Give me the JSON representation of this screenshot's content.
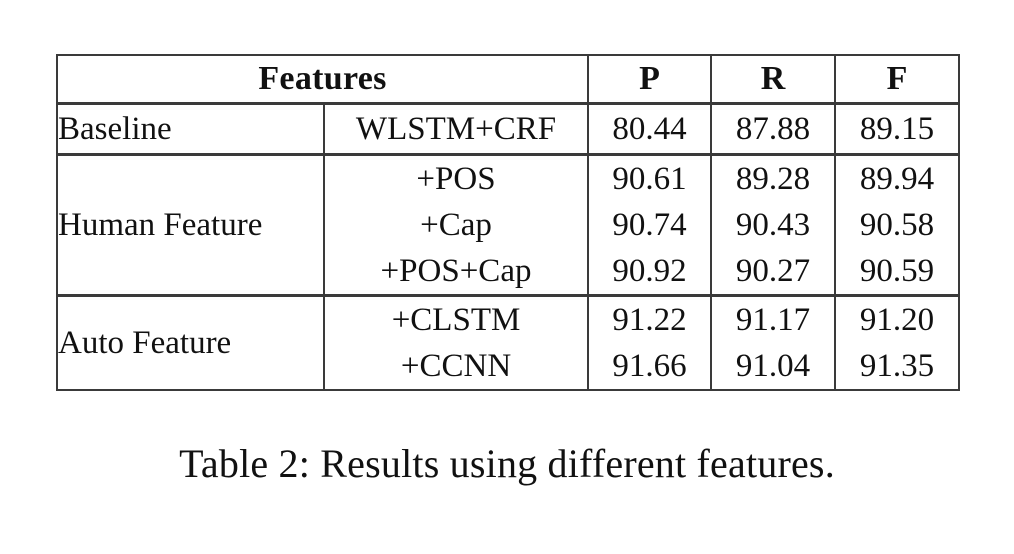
{
  "table": {
    "columns": [
      "Features",
      "P",
      "R",
      "F"
    ],
    "header": {
      "features": "Features",
      "p": "P",
      "r": "R",
      "f": "F"
    },
    "groups": [
      {
        "label": "Baseline",
        "rows": [
          {
            "feature": "WLSTM+CRF",
            "p": "80.44",
            "r": "87.88",
            "f": "89.15"
          }
        ]
      },
      {
        "label": "Human Feature",
        "rows": [
          {
            "feature": "+POS",
            "p": "90.61",
            "r": "89.28",
            "f": "89.94"
          },
          {
            "feature": "+Cap",
            "p": "90.74",
            "r": "90.43",
            "f": "90.58"
          },
          {
            "feature": "+POS+Cap",
            "p": "90.92",
            "r": "90.27",
            "f": "90.59"
          }
        ]
      },
      {
        "label": "Auto Feature",
        "rows": [
          {
            "feature": "+CLSTM",
            "p": "91.22",
            "r": "91.17",
            "f": "91.20"
          },
          {
            "feature": "+CCNN",
            "p": "91.66",
            "r": "91.04",
            "f": "91.35"
          }
        ]
      }
    ]
  },
  "caption": {
    "text": "Table 2: Results using different features."
  },
  "chart_data": {
    "type": "table",
    "title": "Table 2: Results using different features.",
    "columns": [
      "Features",
      "P",
      "R",
      "F"
    ],
    "rows": [
      {
        "group": "Baseline",
        "feature": "WLSTM+CRF",
        "P": 80.44,
        "R": 87.88,
        "F": 89.15
      },
      {
        "group": "Human Feature",
        "feature": "+POS",
        "P": 90.61,
        "R": 89.28,
        "F": 89.94
      },
      {
        "group": "Human Feature",
        "feature": "+Cap",
        "P": 90.74,
        "R": 90.43,
        "F": 90.58
      },
      {
        "group": "Human Feature",
        "feature": "+POS+Cap",
        "P": 90.92,
        "R": 90.27,
        "F": 90.59
      },
      {
        "group": "Auto Feature",
        "feature": "+CLSTM",
        "P": 91.22,
        "R": 91.17,
        "F": 91.2
      },
      {
        "group": "Auto Feature",
        "feature": "+CCNN",
        "P": 91.66,
        "R": 91.04,
        "F": 91.35
      }
    ]
  }
}
